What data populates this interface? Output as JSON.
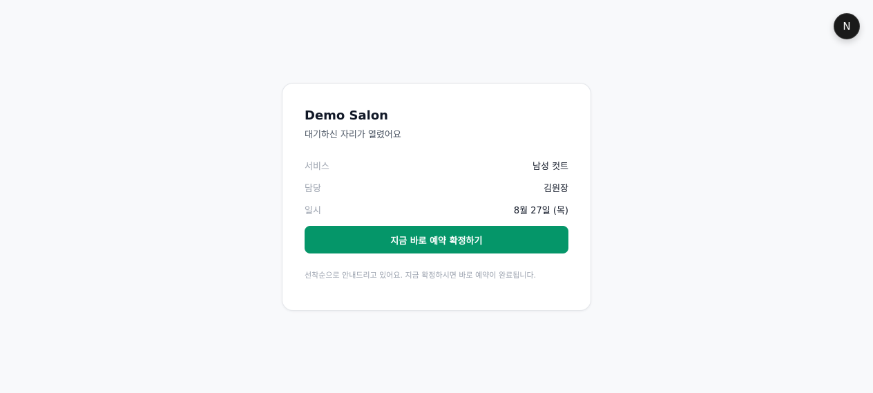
{
  "overlay": {
    "badge_letter": "N"
  },
  "card": {
    "title": "Demo Salon",
    "subtitle": "대기하신 자리가 열렸어요",
    "details": [
      {
        "label": "서비스",
        "value": "남성 컷트"
      },
      {
        "label": "담당",
        "value": "김원장"
      },
      {
        "label": "일시",
        "value": "8월 27일 (목)"
      }
    ],
    "confirm_button_label": "지금 바로 예약 확정하기",
    "note": "선착순으로 안내드리고 있어요. 지금 확정하시면 바로 예약이 완료됩니다."
  },
  "colors": {
    "accent": "#059669",
    "background": "#f8f9fb",
    "card": "#ffffff"
  }
}
